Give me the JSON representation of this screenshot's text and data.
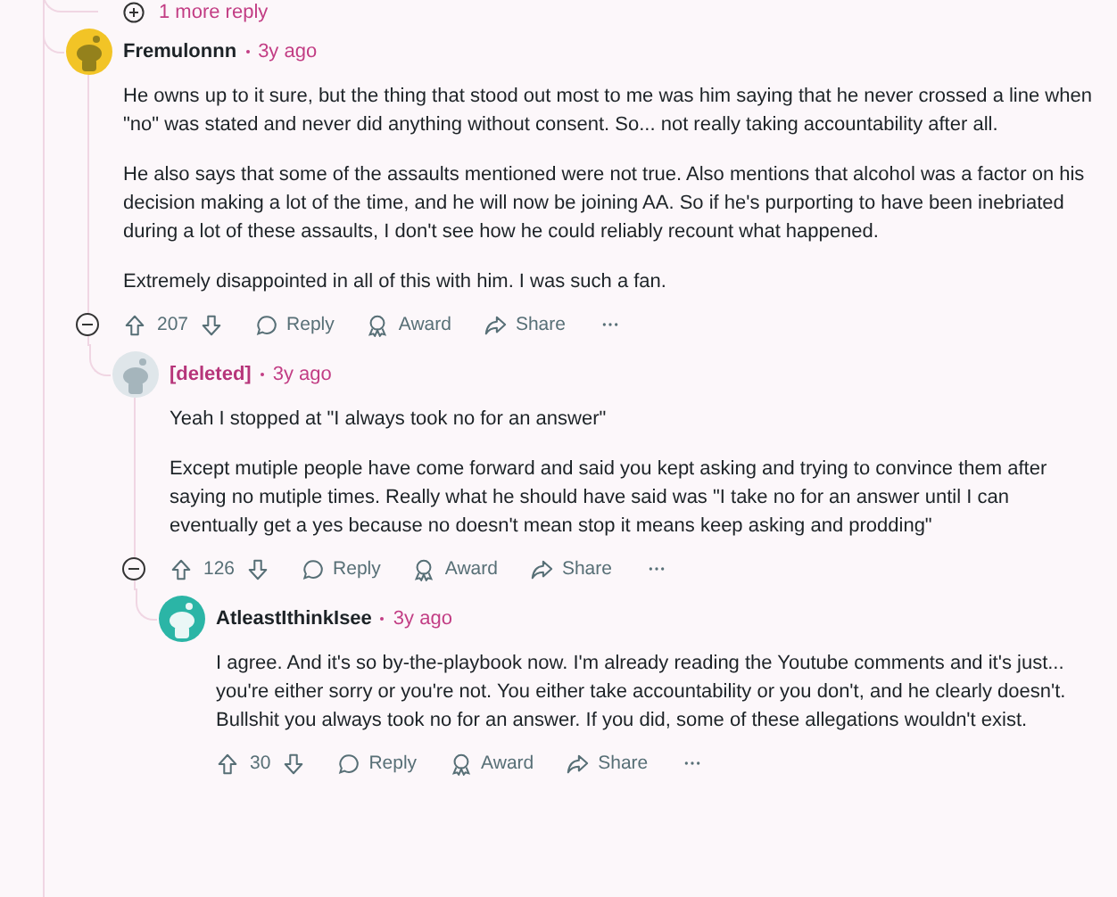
{
  "more_replies": {
    "label": "1 more reply"
  },
  "comments": [
    {
      "author": "Fremulonnn",
      "deleted": false,
      "time": "3y ago",
      "color": "#f2c426",
      "paragraphs": [
        "He owns up to it sure, but the thing that stood out most to me was him saying that he never crossed a line when \"no\" was stated and never did anything without consent. So... not really taking accountability after all.",
        "He also says that some of the assaults mentioned were not true. Also mentions that alcohol was a factor on his decision making a lot of the time, and he will now be joining AA. So if he's purporting to have been inebriated during a lot of these assaults, I don't see how he could reliably recount what happened.",
        "Extremely disappointed in all of this with him. I was such a fan."
      ],
      "score": "207",
      "actions": [
        "Reply",
        "Award",
        "Share"
      ],
      "expanded": true,
      "children": [
        {
          "author": "[deleted]",
          "deleted": true,
          "time": "3y ago",
          "color": "#dfe6ea",
          "paragraphs": [
            "Yeah I stopped at \"I always took no for an answer\"",
            "Except mutiple people have come forward and said you kept asking and trying to convince them after saying no mutiple times. Really what he should have said was \"I take no for an answer until I can eventually get a yes because no doesn't mean stop it means keep asking and prodding\""
          ],
          "score": "126",
          "actions": [
            "Reply",
            "Award",
            "Share"
          ],
          "expanded": true,
          "children": [
            {
              "author": "AtleastIthinkIsee",
              "deleted": false,
              "time": "3y ago",
              "color": "#2bb5a6",
              "paragraphs": [
                "I agree. And it's so by-the-playbook now. I'm already reading the Youtube comments and it's just... you're either sorry or you're not. You either take accountability or you don't, and he clearly doesn't. Bullshit you always took no for an answer. If you did, some of these allegations wouldn't exist."
              ],
              "score": "30",
              "actions": [
                "Reply",
                "Award",
                "Share"
              ]
            }
          ]
        }
      ]
    }
  ]
}
